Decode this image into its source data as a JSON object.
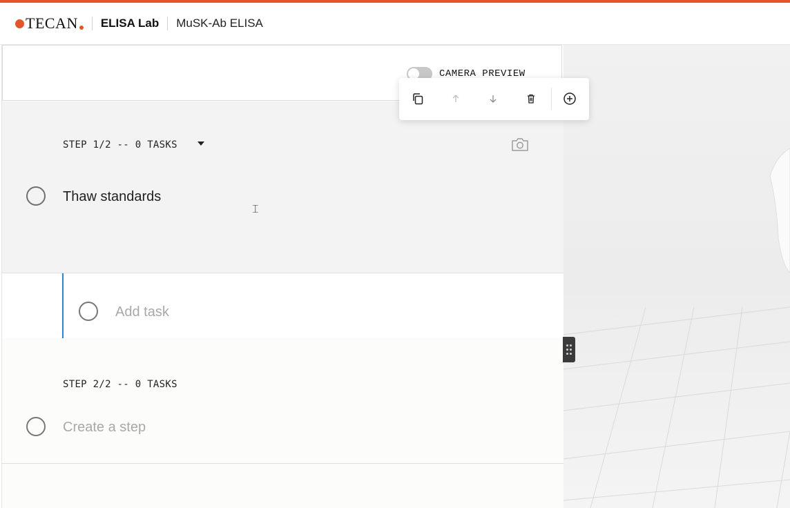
{
  "colors": {
    "accent": "#e2562a",
    "blue": "#2f7fd8"
  },
  "header": {
    "logo_text": "TECAN",
    "app_name": "ELISA Lab",
    "project_name": "MuSK-Ab ELISA"
  },
  "camera": {
    "label": "CAMERA PREVIEW",
    "enabled": false
  },
  "toolbar": {
    "buttons": [
      {
        "name": "duplicate",
        "icon": "copy-icon"
      },
      {
        "name": "move-up",
        "icon": "arrow-up-icon"
      },
      {
        "name": "move-down",
        "icon": "arrow-down-icon"
      },
      {
        "name": "delete",
        "icon": "trash-icon"
      },
      {
        "name": "add",
        "icon": "plus-circle-icon"
      }
    ]
  },
  "steps": [
    {
      "title": "STEP 1/2 -- 0 TASKS",
      "task": "Thaw standards",
      "add_task_placeholder": "Add task"
    },
    {
      "title": "STEP 2/2 -- 0 TASKS",
      "create_placeholder": "Create a step"
    }
  ]
}
